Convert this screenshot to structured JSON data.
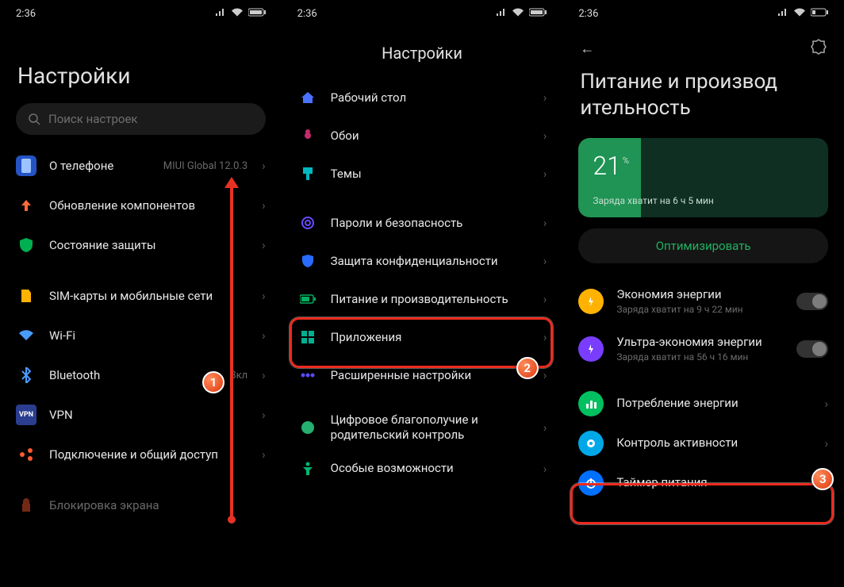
{
  "status": {
    "time": "2:36"
  },
  "p1": {
    "title": "Настройки",
    "search_placeholder": "Поиск настроек",
    "items": [
      {
        "label": "О телефоне",
        "value": "MIUI Global 12.0.3",
        "icon": "phone-icon",
        "color": "#3d7dff"
      },
      {
        "label": "Обновление компонентов",
        "icon": "arrow-up-icon",
        "color": "#ff5a30"
      },
      {
        "label": "Состояние защиты",
        "icon": "shield-icon",
        "color": "#00c060"
      }
    ],
    "items2": [
      {
        "label": "SIM-карты и мобильные сети",
        "icon": "sim-icon",
        "color": "#ffb300"
      },
      {
        "label": "Wi-Fi",
        "icon": "wifi-icon",
        "color": "#3d90ff"
      },
      {
        "label": "Bluetooth",
        "value": "Вкл",
        "icon": "bluetooth-icon",
        "color": "#3d90ff"
      },
      {
        "label": "VPN",
        "icon": "vpn-icon",
        "color": "#2b3d8f"
      },
      {
        "label": "Подключение и общий доступ",
        "icon": "share-icon",
        "color": "#ff5a30"
      }
    ],
    "cutoff": "Блокировка экрана"
  },
  "p2": {
    "title": "Настройки",
    "items": [
      {
        "label": "Рабочий стол",
        "icon": "home-icon",
        "color": "#4a72ff"
      },
      {
        "label": "Обои",
        "icon": "flower-icon",
        "color": "#c62a6b"
      },
      {
        "label": "Темы",
        "icon": "brush-icon",
        "color": "#00b8c0"
      }
    ],
    "items2": [
      {
        "label": "Пароли и безопасность",
        "icon": "fingerprint-icon",
        "color": "#6a4aff"
      },
      {
        "label": "Защита конфиденциальности",
        "icon": "shield-key-icon",
        "color": "#2a6bff"
      },
      {
        "label": "Питание и производительность",
        "icon": "battery-icon",
        "color": "#00b060"
      },
      {
        "label": "Приложения",
        "icon": "apps-icon",
        "color": "#00b090"
      },
      {
        "label": "Расширенные настройки",
        "icon": "more-icon",
        "color": "#5a4aff"
      }
    ],
    "items3": [
      {
        "label": "Цифровое благополучие и родительский контроль",
        "icon": "wellbeing-icon",
        "color": "#25b070"
      },
      {
        "label": "Особые возможности",
        "icon": "accessibility-icon",
        "color": "#00b870"
      }
    ]
  },
  "p3": {
    "title": "Питание и производ\nительность",
    "battery_pct": "21",
    "battery_sub": "Заряда хватит на 6 ч 5 мин",
    "optimize": "Оптимизировать",
    "savers": [
      {
        "label": "Экономия энергии",
        "sub": "Заряда хватит на 9 ч 22 мин",
        "icon": "battery-saver-icon",
        "color": "#ffb300"
      },
      {
        "label": "Ультра-экономия энергии",
        "sub": "Заряда хватит на 56 ч 16 мин",
        "icon": "ultra-saver-icon",
        "color": "#7a3dff"
      }
    ],
    "links": [
      {
        "label": "Потребление энергии",
        "icon": "chart-icon",
        "color": "#00c060"
      },
      {
        "label": "Контроль активности",
        "icon": "activity-icon",
        "color": "#00a8e8"
      },
      {
        "label": "Таймер питания",
        "icon": "power-icon",
        "color": "#0070ff"
      }
    ]
  },
  "badges": {
    "b1": "1",
    "b2": "2",
    "b3": "3"
  }
}
